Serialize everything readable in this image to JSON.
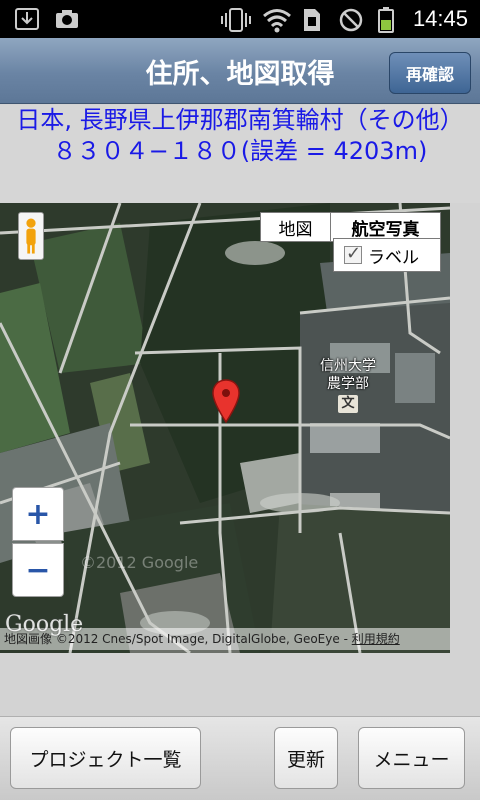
{
  "status_bar": {
    "time": "14:45",
    "icons": [
      "download-icon",
      "camera-icon",
      "vibrate-icon",
      "wifi-icon",
      "sim-icon",
      "no-sim-icon",
      "battery-icon"
    ]
  },
  "header": {
    "title": "住所、地図取得",
    "recheck_label": "再確認"
  },
  "address": {
    "text": "日本, 長野県上伊那郡南箕輪村（その他）８３０４−１８０(誤差 = 4203m)"
  },
  "map": {
    "type_map_label": "地図",
    "type_satellite_label": "航空写真",
    "label_toggle": "ラベル",
    "label_checked": true,
    "zoom_in_label": "+",
    "zoom_out_label": "−",
    "place_label_line1": "信州大学",
    "place_label_line2": "農学部",
    "place_mark": "文",
    "google_logo": "Google",
    "attribution": "地図画像 ©2012 Cnes/Spot Image, DigitalGlobe, GeoEye - ",
    "terms_link": "利用規約",
    "watermark": "©2012 Google",
    "pin_color": "#e8332d"
  },
  "bottom_bar": {
    "projects_label": "プロジェクト一覧",
    "refresh_label": "更新",
    "menu_label": "メニュー"
  },
  "colors": {
    "address_text": "#1a1ae6",
    "title_bar": "#6a84a4"
  }
}
